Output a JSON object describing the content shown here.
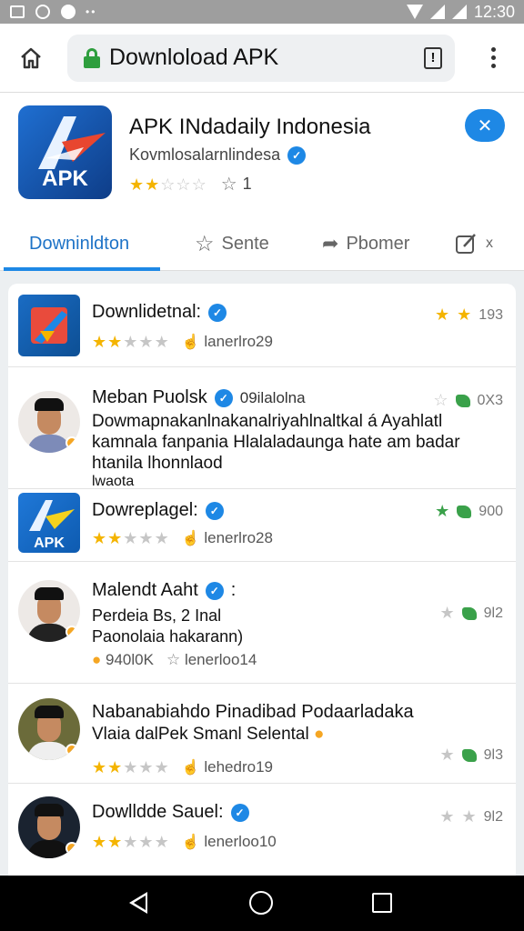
{
  "statusbar": {
    "time": "12:30"
  },
  "toolbar": {
    "url": "Downloload APK"
  },
  "app": {
    "title": "APK INdadaily Indonesia",
    "developer": "Kovmlosalarnlindesa",
    "rating_stars": 2,
    "rating_count": "1",
    "logo_text": "APK"
  },
  "tabs": [
    {
      "label": "Downinldton"
    },
    {
      "label": "Sente"
    },
    {
      "label": "Pbomer"
    },
    {
      "label": "x"
    }
  ],
  "list": [
    {
      "title": "Downlidetnal:",
      "stars": 2,
      "meta": "lanerlro29",
      "right_value": "193",
      "type": "app"
    },
    {
      "title": "Meban Puolsk",
      "extra": "09ilalolna",
      "body": [
        "Dowmapnakanlnakanalriyahlnaltkal á Ayahlatl",
        "kamnala fanpania Hlalaladaunga hate am badar",
        "htanila lhonnlaod",
        "lwaota"
      ],
      "right_value": "0X3",
      "type": "avatar"
    },
    {
      "title": "Dowreplagel:",
      "stars": 2,
      "meta": "lenerlro28",
      "right_value": "900",
      "type": "app2"
    },
    {
      "title": "Malendt Aaht",
      "extra": ":",
      "body": [
        "Perdeia Bs, 2 Inal",
        "Paonolaia hakarann)"
      ],
      "meta_prefix": "940l0K",
      "meta": "lenerloo14",
      "right_value": "9l2",
      "type": "avatar"
    },
    {
      "title": "Nabanabiahdo Pinadibad Podaarladaka",
      "body": [
        "Vlaia dalPek Smanl Selental"
      ],
      "stars": 2,
      "meta": "lehedro19",
      "right_value": "9l3",
      "type": "avatar2"
    },
    {
      "title": "Dowlldde Sauel:",
      "stars": 2,
      "meta": "lenerloo10",
      "right_value": "9l2",
      "type": "avatar3"
    }
  ]
}
